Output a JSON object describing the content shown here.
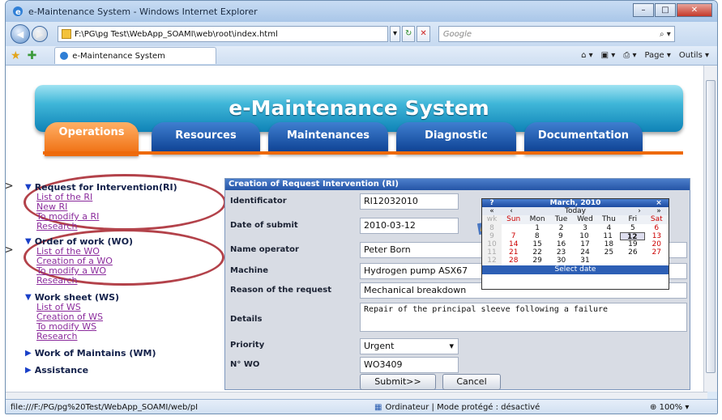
{
  "window": {
    "title": "e-Maintenance System - Windows Internet Explorer"
  },
  "browser": {
    "address": "F:\\PG\\pg Test\\WebApp_SOAMI\\web\\root\\index.html",
    "search_placeholder": "Google",
    "tab_title": "e-Maintenance System",
    "cmd_page": "Page ▾",
    "cmd_tools": "Outils ▾"
  },
  "site": {
    "title": "e-Maintenance System"
  },
  "menu": [
    "Operations",
    "Resources",
    "Maintenances",
    "Diagnostic",
    "Documentation"
  ],
  "sidebar": {
    "ri": {
      "title": "Request for Intervention(RI)",
      "links": [
        "List of the RI",
        "New RI",
        "To modify a RI",
        "Research"
      ]
    },
    "wo": {
      "title": "Order of work (WO)",
      "links": [
        "List of the WO",
        "Creation of a WO",
        "To modify a WO",
        "Research"
      ]
    },
    "ws": {
      "title": "Work sheet (WS)",
      "links": [
        "List of WS",
        "Creation of WS",
        "To modify WS",
        "Research"
      ]
    },
    "wm": {
      "title": "Work of Maintains (WM)"
    },
    "assist": {
      "title": "Assistance"
    }
  },
  "form": {
    "header": "Creation of Request Intervention (RI)",
    "identificator_label": "Identificator",
    "identificator": "RI12032010",
    "date_label": "Date of submit",
    "date": "2010-03-12",
    "operator_label": "Name operator",
    "operator": "Peter Born",
    "machine_label": "Machine",
    "machine": "Hydrogen pump ASX67",
    "reason_label": "Reason of the request",
    "reason": "Mechanical breakdown",
    "details_label": "Details",
    "details": "Repair of the principal sleeve following a failure",
    "priority_label": "Priority",
    "priority": "Urgent",
    "wo_label": "N° WO",
    "wo": "WO3409",
    "submit": "Submit>>",
    "cancel": "Cancel"
  },
  "calendar": {
    "month": "March, 2010",
    "help": "?",
    "close": "×",
    "prev_year": "«",
    "prev": "‹",
    "today": "Today",
    "next": "›",
    "next_year": "»",
    "wk_label": "wk",
    "days": [
      "Sun",
      "Mon",
      "Tue",
      "Wed",
      "Thu",
      "Fri",
      "Sat"
    ],
    "weeks": [
      {
        "wk": "8",
        "d": [
          "",
          "1",
          "2",
          "3",
          "4",
          "5",
          "6"
        ]
      },
      {
        "wk": "9",
        "d": [
          "7",
          "8",
          "9",
          "10",
          "11",
          "12",
          "13"
        ]
      },
      {
        "wk": "10",
        "d": [
          "14",
          "15",
          "16",
          "17",
          "18",
          "19",
          "20"
        ]
      },
      {
        "wk": "11",
        "d": [
          "21",
          "22",
          "23",
          "24",
          "25",
          "26",
          "27"
        ]
      },
      {
        "wk": "12",
        "d": [
          "28",
          "29",
          "30",
          "31",
          "",
          "",
          ""
        ]
      }
    ],
    "selected": "12",
    "footer": "Select date"
  },
  "status": {
    "url": "file:///F:/PG/pg%20Test/WebApp_SOAMI/web/pI",
    "zone": "Ordinateur | Mode protégé : désactivé",
    "zoom": "100%"
  }
}
